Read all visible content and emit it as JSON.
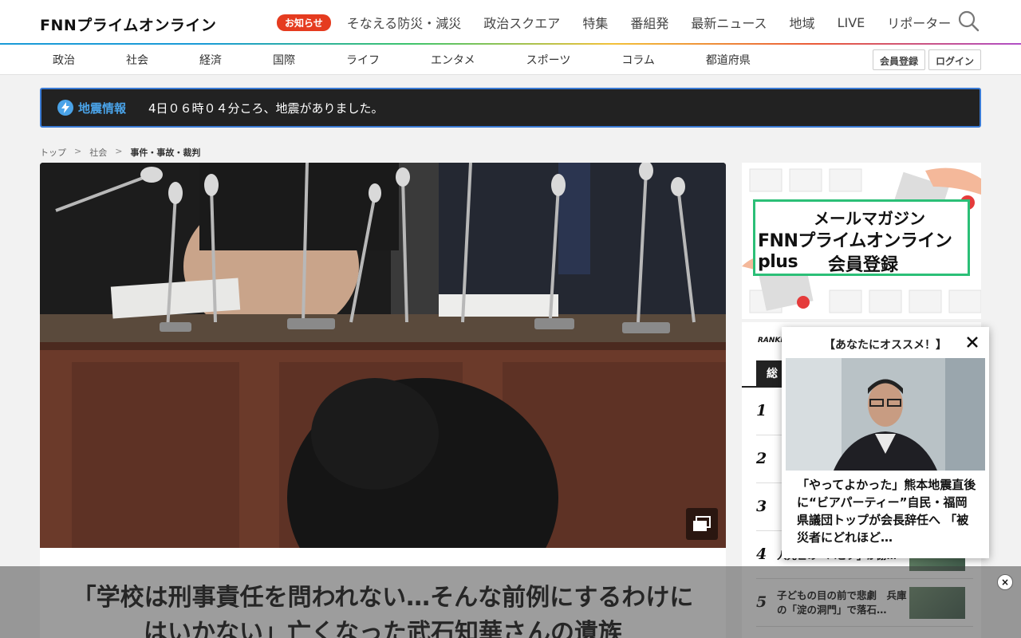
{
  "header": {
    "logo": "FNNプライムオンライン",
    "notice_badge": "お知らせ",
    "nav": [
      "そなえる防災・減災",
      "政治スクエア",
      "特集",
      "番組発",
      "最新ニュース",
      "地域",
      "LIVE",
      "リポーター"
    ]
  },
  "subnav": {
    "categories": [
      "政治",
      "社会",
      "経済",
      "国際",
      "ライフ",
      "エンタメ",
      "スポーツ",
      "コラム",
      "都道府県"
    ],
    "register": "会員登録",
    "login": "ログイン"
  },
  "quake": {
    "label": "地震情報",
    "text": "4日０６時０４分ころ、地震がありました。"
  },
  "breadcrumb": [
    "トップ",
    "社会",
    "事件・事故・裁判"
  ],
  "article": {
    "title": "「学校は刑事責任を問われない…そんな前例にするわけにはいかない」亡くなった武石知華さんの遺族"
  },
  "ad": {
    "line1": "メールマガジン",
    "line2": "FNNプライムオンラインplus",
    "line3": "会員登録"
  },
  "ranking": {
    "heading": "RANKING",
    "items": [
      {
        "num": "1",
        "text": ""
      },
      {
        "num": "2",
        "text": ""
      },
      {
        "num": "3",
        "text": ""
      },
      {
        "num": "4",
        "text": "人死亡の「ハビタ」が謝…"
      },
      {
        "num": "5",
        "text": "子どもの目の前で悲劇　兵庫の「淀の洞門」で落石…"
      }
    ]
  },
  "popup": {
    "heading": "【あなたにオススメ！】",
    "text": "「やってよかった」熊本地震直後に“ビアパーティー”自民・福岡県議団トップが会長辞任へ 「被災者にどれほど…"
  },
  "colors": {
    "accent_green": "#2bbf77",
    "quake_blue": "#4aa3e8",
    "notice_red": "#e53b1f"
  }
}
